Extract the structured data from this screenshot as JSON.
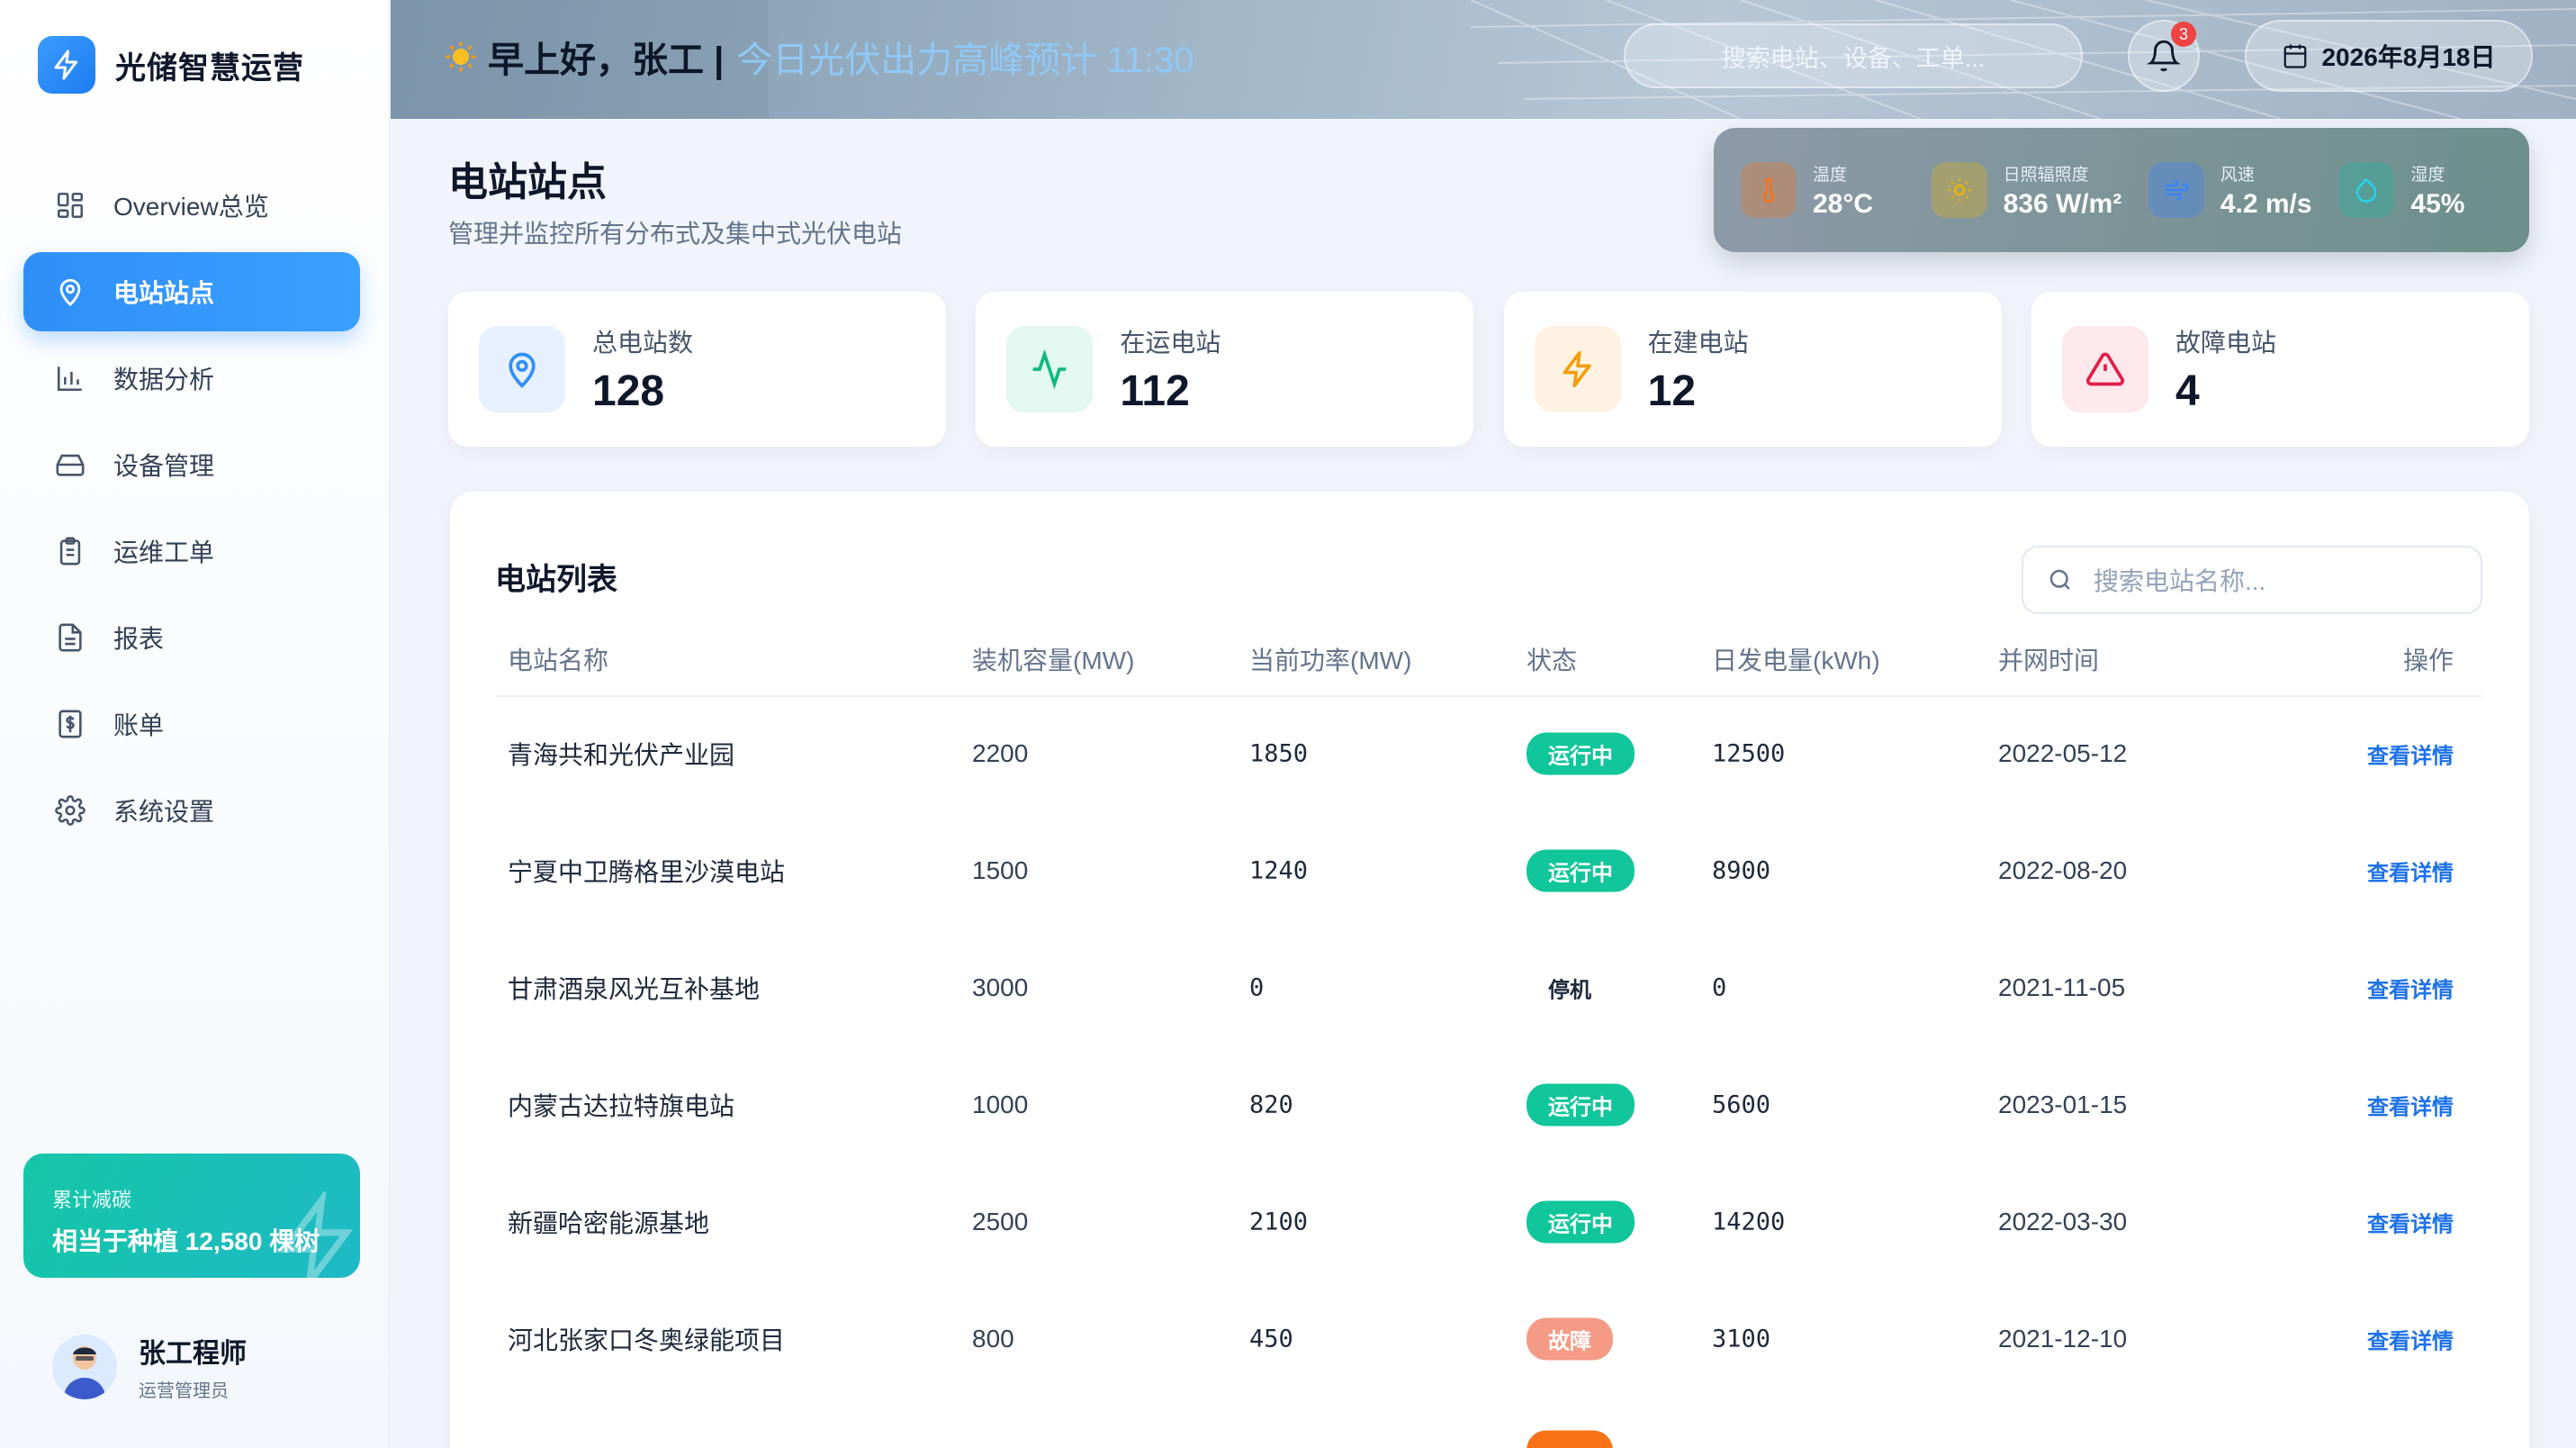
{
  "app": {
    "name": "光储智慧运营"
  },
  "sidebar": {
    "items": [
      {
        "label": "Overview总览",
        "icon": "grid-icon",
        "active": false
      },
      {
        "label": "电站站点",
        "icon": "map-pin-icon",
        "active": true
      },
      {
        "label": "数据分析",
        "icon": "bar-chart-icon",
        "active": false
      },
      {
        "label": "设备管理",
        "icon": "hard-drive-icon",
        "active": false
      },
      {
        "label": "运维工单",
        "icon": "clipboard-icon",
        "active": false
      },
      {
        "label": "报表",
        "icon": "document-icon",
        "active": false
      },
      {
        "label": "账单",
        "icon": "dollar-receipt-icon",
        "active": false
      },
      {
        "label": "系统设置",
        "icon": "gear-icon",
        "active": false
      }
    ],
    "eco_card": {
      "label": "累计减碳",
      "value": "相当于种植 12,580 棵树"
    },
    "user": {
      "name": "张工程师",
      "role": "运营管理员"
    }
  },
  "header": {
    "greeting": "早上好，张工 |",
    "peak_text": "今日光伏出力高峰预计 11:30",
    "search_placeholder": "搜索电站、设备、工单...",
    "notification_count": "3",
    "date": "2026年8月18日"
  },
  "page": {
    "title": "电站站点",
    "subtitle": "管理并监控所有分布式及集中式光伏电站"
  },
  "weather": [
    {
      "label": "温度",
      "value": "28°C",
      "icon": "thermometer-icon"
    },
    {
      "label": "日照辐照度",
      "value": "836 W/m²",
      "icon": "sun-icon"
    },
    {
      "label": "风速",
      "value": "4.2 m/s",
      "icon": "wind-icon"
    },
    {
      "label": "湿度",
      "value": "45%",
      "icon": "droplet-icon"
    }
  ],
  "stats": [
    {
      "label": "总电站数",
      "value": "128",
      "icon": "map-pin-icon"
    },
    {
      "label": "在运电站",
      "value": "112",
      "icon": "activity-icon"
    },
    {
      "label": "在建电站",
      "value": "12",
      "icon": "lightning-icon"
    },
    {
      "label": "故障电站",
      "value": "4",
      "icon": "warning-icon"
    }
  ],
  "table": {
    "title": "电站列表",
    "search_placeholder": "搜索电站名称...",
    "columns": [
      "电站名称",
      "装机容量(MW)",
      "当前功率(MW)",
      "状态",
      "日发电量(kWh)",
      "并网时间",
      "操作"
    ],
    "rows": [
      {
        "name": "青海共和光伏产业园",
        "capacity": "2200",
        "power": "1850",
        "status": "运行中",
        "daily": "12500",
        "date": "2022-05-12",
        "action": "查看详情"
      },
      {
        "name": "宁夏中卫腾格里沙漠电站",
        "capacity": "1500",
        "power": "1240",
        "status": "运行中",
        "daily": "8900",
        "date": "2022-08-20",
        "action": "查看详情"
      },
      {
        "name": "甘肃酒泉风光互补基地",
        "capacity": "3000",
        "power": "0",
        "status": "停机",
        "daily": "0",
        "date": "2021-11-05",
        "action": "查看详情"
      },
      {
        "name": "内蒙古达拉特旗电站",
        "capacity": "1000",
        "power": "820",
        "status": "运行中",
        "daily": "5600",
        "date": "2023-01-15",
        "action": "查看详情"
      },
      {
        "name": "新疆哈密能源基地",
        "capacity": "2500",
        "power": "2100",
        "status": "运行中",
        "daily": "14200",
        "date": "2022-03-30",
        "action": "查看详情"
      },
      {
        "name": "河北张家口冬奥绿能项目",
        "capacity": "800",
        "power": "450",
        "status": "故障",
        "daily": "3100",
        "date": "2021-12-10",
        "action": "查看详情"
      }
    ]
  }
}
